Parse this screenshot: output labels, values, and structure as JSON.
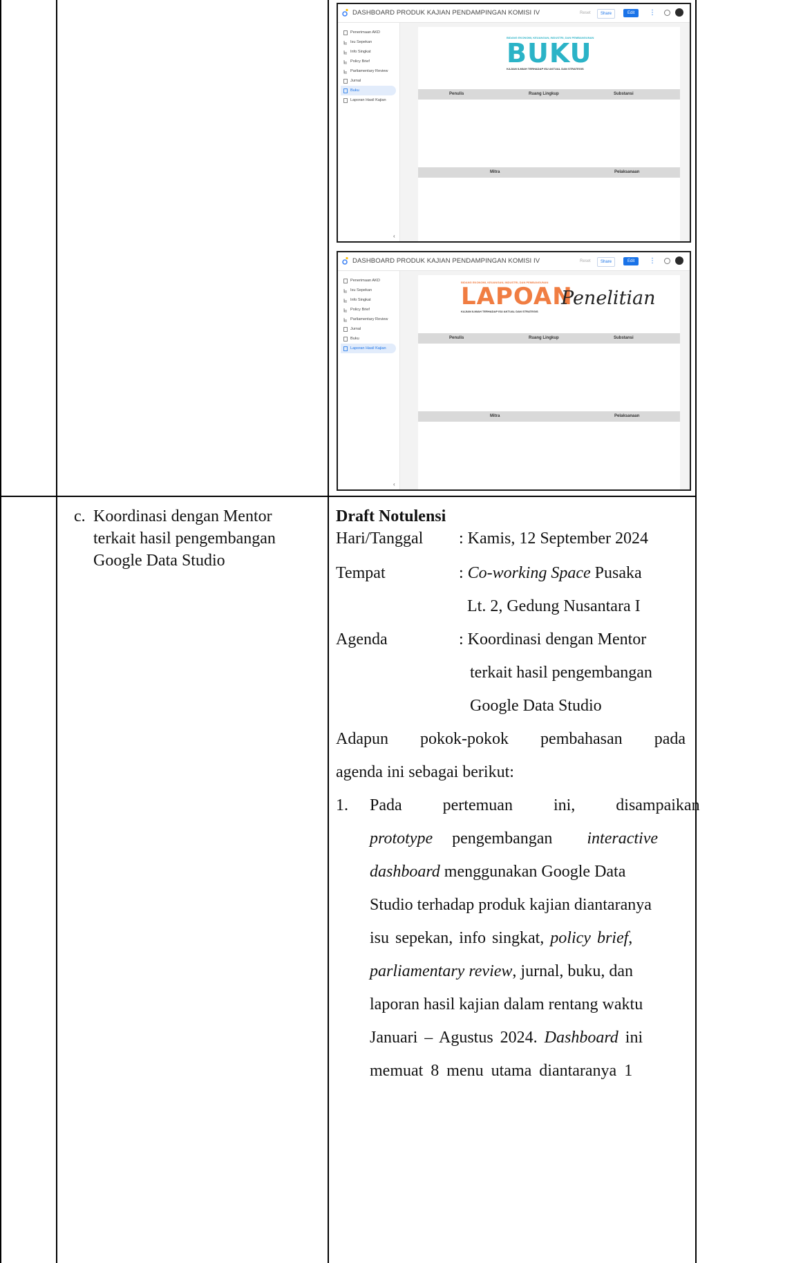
{
  "screenshot_1": {
    "dashboard_title": "DASHBOARD PRODUK KAJIAN PENDAMPINGAN KOMISI IV",
    "toolbar": {
      "reset": "Reset",
      "share": "Share",
      "edit": "Edit"
    },
    "nav": [
      "Penerimaan AKD",
      "Isu Sepekan",
      "Info Singkat",
      "Policy Brief",
      "Parliamentary Review",
      "Jurnal",
      "Buku",
      "Laporan Hasil Kajian"
    ],
    "active_nav": "Buku",
    "banner_small": "BIDANG EKONOMI, KEUANGAN, INDUSTRI, DAN PEMBANGUNAN",
    "banner_title": "BUKU",
    "banner_sub": "KAJIAN ILMIAH TERHADAP ISU AKTUAL DAN STRATEGIS",
    "header_row_1": [
      "Penulis",
      "Ruang Lingkup",
      "Substansi"
    ],
    "header_row_2": [
      "Mitra",
      "Pelaksanaan"
    ]
  },
  "screenshot_2": {
    "dashboard_title": "DASHBOARD PRODUK KAJIAN PENDAMPINGAN KOMISI IV",
    "toolbar": {
      "reset": "Reset",
      "share": "Share",
      "edit": "Edit"
    },
    "nav": [
      "Penerimaan AKD",
      "Isu Sepekan",
      "Info Singkat",
      "Policy Brief",
      "Parliamentary Review",
      "Jurnal",
      "Buku",
      "Laporan Hasil Kajian"
    ],
    "active_nav": "Laporan Hasil Kajian",
    "banner_small": "BIDANG EKONOMI, KEUANGAN, INDUSTRI, DAN PEMBANGUNAN",
    "banner_title": "LAPOAN",
    "banner_script": "Penelitian",
    "banner_sub": "KAJIAN ILMIAH TERHADAP ISU AKTUAL DAN STRATEGIS",
    "header_row_1": [
      "Penulis",
      "Ruang Lingkup",
      "Substansi"
    ],
    "header_row_2": [
      "Mitra",
      "Pelaksanaan"
    ]
  },
  "left_item": {
    "marker": "c.",
    "lines": [
      "Koordinasi dengan Mentor",
      "terkait hasil pengembangan",
      "Google Data Studio"
    ]
  },
  "notes": {
    "heading": "Draft Notulensi",
    "hari_label": "Hari/Tanggal",
    "hari_value": ": Kamis, 12 September 2024",
    "tempat_label": "Tempat",
    "tempat_colon": ":",
    "tempat_italic": "Co-working Space",
    "tempat_rest": "Pusaka",
    "tempat_line2": "Lt. 2, Gedung Nusantara I",
    "agenda_label": "Agenda",
    "agenda_line1": ": Koordinasi dengan Mentor",
    "agenda_line2": "terkait hasil pengembangan",
    "agenda_line3": "Google Data Studio",
    "intro_line1": "Adapun pokok-pokok pembahasan pada",
    "intro_line2": "agenda ini sebagai berikut:",
    "point_number": "1.",
    "p1": "Pada pertemuan ini, disampaikan",
    "p2a": "prototype",
    "p2b": "pengembangan",
    "p2c": "interactive",
    "p3a": "dashboard",
    "p3b": "menggunakan Google Data",
    "p4": "Studio terhadap produk kajian diantaranya",
    "p5a": "isu sepekan, info singkat,",
    "p5b": "policy brief",
    "p5c": ",",
    "p6a": "parliamentary review",
    "p6b": ", jurnal, buku, dan",
    "p7": "laporan hasil kajian dalam rentang waktu",
    "p8a": "Januari – Agustus 2024.",
    "p8b": "Dashboard",
    "p8c": "ini",
    "p9": "memuat 8 menu utama diantaranya 1"
  },
  "colors": {
    "buku_blue": "#2bb3c7",
    "laporan_orange": "#f07d42",
    "header_band": "#d9d9d9",
    "accent": "#1a73e8"
  }
}
